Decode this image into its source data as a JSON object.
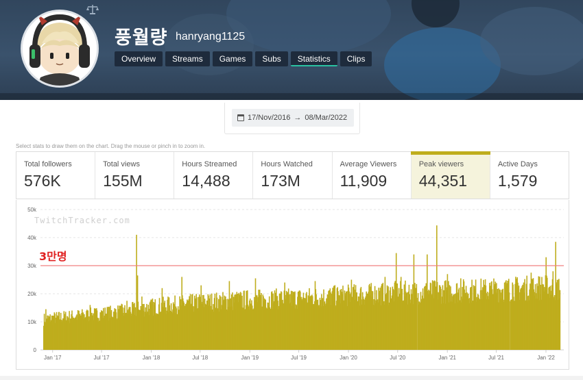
{
  "profile": {
    "display_name": "풍월량",
    "login": "hanryang1125",
    "avatar_icon": "avatar-cartoon-headphones",
    "partner_icon": "balance-scale-icon"
  },
  "nav": {
    "tabs": [
      {
        "label": "Overview",
        "active": false
      },
      {
        "label": "Streams",
        "active": false
      },
      {
        "label": "Games",
        "active": false
      },
      {
        "label": "Subs",
        "active": false
      },
      {
        "label": "Statistics",
        "active": true
      },
      {
        "label": "Clips",
        "active": false
      }
    ]
  },
  "date_range": {
    "start": "17/Nov/2016",
    "arrow": "→",
    "end": "08/Mar/2022"
  },
  "hint": "Select stats to draw them on the chart. Drag the mouse or pinch in to zoom in.",
  "stats": [
    {
      "label": "Total followers",
      "value": "576K",
      "selected": false
    },
    {
      "label": "Total views",
      "value": "155M",
      "selected": false
    },
    {
      "label": "Hours Streamed",
      "value": "14,488",
      "selected": false
    },
    {
      "label": "Hours Watched",
      "value": "173M",
      "selected": false
    },
    {
      "label": "Average Viewers",
      "value": "11,909",
      "selected": false
    },
    {
      "label": "Peak viewers",
      "value": "44,351",
      "selected": true
    },
    {
      "label": "Active Days",
      "value": "1,579",
      "selected": false
    }
  ],
  "colors": {
    "accent_bar": "#bfad1d",
    "threshold_line": "#f08080",
    "annotation_text": "#e02020",
    "tab_bg": "#1e2b3c",
    "tab_active_underline": "#2ac3a2"
  },
  "chart_data": {
    "type": "bar",
    "watermark": "TwitchTracker.com",
    "annotation": "3만명",
    "threshold": 30000,
    "ylim": [
      0,
      50000
    ],
    "y_ticks": [
      "0",
      "10k",
      "20k",
      "30k",
      "40k",
      "50k"
    ],
    "y_tick_values": [
      0,
      10000,
      20000,
      30000,
      40000,
      50000
    ],
    "x_ticks": [
      "Jan '17",
      "Jul '17",
      "Jan '18",
      "Jul '18",
      "Jan '19",
      "Jul '19",
      "Jan '20",
      "Jul '20",
      "Jan '21",
      "Jul '21",
      "Jan '22"
    ],
    "x_range": [
      "2016-11-17",
      "2022-03-08"
    ],
    "series": [
      {
        "metric": "Peak viewers",
        "baseline": [
          [
            "2016-11-17",
            11000
          ],
          [
            "2017-01-01",
            11500
          ],
          [
            "2017-07-01",
            13000
          ],
          [
            "2017-10-01",
            14000
          ],
          [
            "2018-01-01",
            15500
          ],
          [
            "2018-07-01",
            17000
          ],
          [
            "2019-01-01",
            18000
          ],
          [
            "2019-07-01",
            18500
          ],
          [
            "2020-01-01",
            19500
          ],
          [
            "2020-07-01",
            20500
          ],
          [
            "2021-01-01",
            21000
          ],
          [
            "2021-07-01",
            21500
          ],
          [
            "2022-01-01",
            22500
          ],
          [
            "2022-03-08",
            22000
          ]
        ],
        "peaks": [
          [
            "2016-11-25",
            14500
          ],
          [
            "2017-05-10",
            16000
          ],
          [
            "2017-09-25",
            17500
          ],
          [
            "2017-11-01",
            41000
          ],
          [
            "2017-11-05",
            26500
          ],
          [
            "2017-11-20",
            19000
          ],
          [
            "2018-02-05",
            22000
          ],
          [
            "2018-04-20",
            26000
          ],
          [
            "2018-07-01",
            23000
          ],
          [
            "2018-10-15",
            24500
          ],
          [
            "2019-01-20",
            25500
          ],
          [
            "2019-05-10",
            24000
          ],
          [
            "2019-09-01",
            24500
          ],
          [
            "2020-01-15",
            25000
          ],
          [
            "2020-05-20",
            26000
          ],
          [
            "2020-07-01",
            34500
          ],
          [
            "2020-07-20",
            26000
          ],
          [
            "2020-09-05",
            34000
          ],
          [
            "2020-10-25",
            34000
          ],
          [
            "2020-12-01",
            44351
          ],
          [
            "2021-01-10",
            27000
          ],
          [
            "2021-03-01",
            25500
          ],
          [
            "2021-09-10",
            24000
          ],
          [
            "2021-11-20",
            27500
          ],
          [
            "2022-01-15",
            33000
          ],
          [
            "2022-02-10",
            28000
          ],
          [
            "2022-02-20",
            38500
          ],
          [
            "2022-03-01",
            25000
          ]
        ],
        "gaps": [
          "2020-09-20",
          "2021-09-01"
        ]
      }
    ]
  }
}
